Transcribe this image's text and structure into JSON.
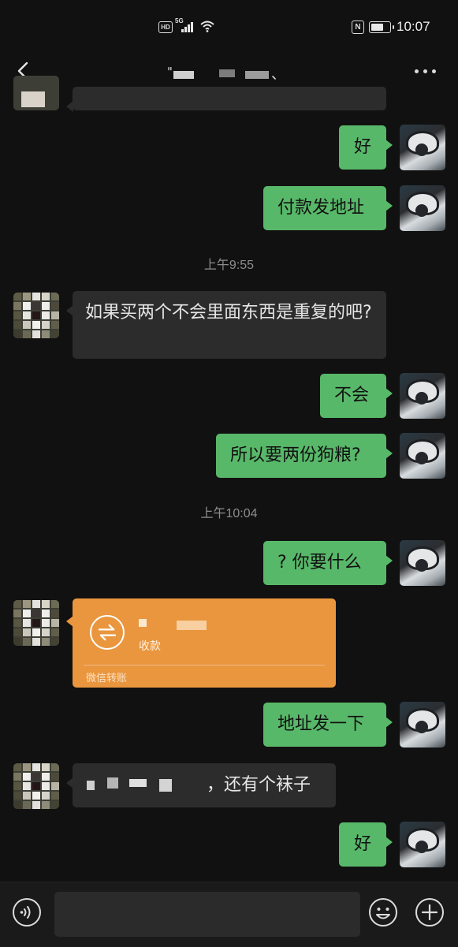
{
  "status_bar": {
    "hd": "HD",
    "network": "5G",
    "nfc": "N",
    "time": "10:07"
  },
  "header": {
    "title": "\"",
    "title_tail": "、",
    "icons": {
      "back": "chevron-left-icon",
      "more": "more-dots-icon"
    }
  },
  "messages": [
    {
      "id": "m1",
      "side": "out",
      "text": "好"
    },
    {
      "id": "m2",
      "side": "out",
      "text": "付款发地址"
    },
    {
      "id": "t1",
      "type": "time",
      "text": "上午9:55"
    },
    {
      "id": "m3",
      "side": "in",
      "text": "如果买两个不会里面东西是重复的吧?"
    },
    {
      "id": "m4",
      "side": "out",
      "text": "不会"
    },
    {
      "id": "m5",
      "side": "out",
      "text": "所以要两份狗粮?"
    },
    {
      "id": "t2",
      "type": "time",
      "text": "上午10:04"
    },
    {
      "id": "m6",
      "side": "out",
      "text": "? 你要什么"
    },
    {
      "id": "m7",
      "side": "in",
      "type": "transfer",
      "label": "微信转账",
      "note": "收款",
      "icon": "transfer-arrows-icon"
    },
    {
      "id": "m8",
      "side": "out",
      "text": "地址发一下"
    },
    {
      "id": "m9",
      "side": "in",
      "text": "，还有个袜子"
    },
    {
      "id": "m10",
      "side": "out",
      "text": "好"
    }
  ],
  "input_bar": {
    "placeholder": "",
    "icons": {
      "voice": "voice-icon",
      "emoji": "emoji-icon",
      "plus": "plus-icon"
    }
  },
  "colors": {
    "background": "#111111",
    "outgoing_bubble": "#58b869",
    "incoming_bubble": "#2c2c2c",
    "transfer_card": "#e9963e"
  }
}
